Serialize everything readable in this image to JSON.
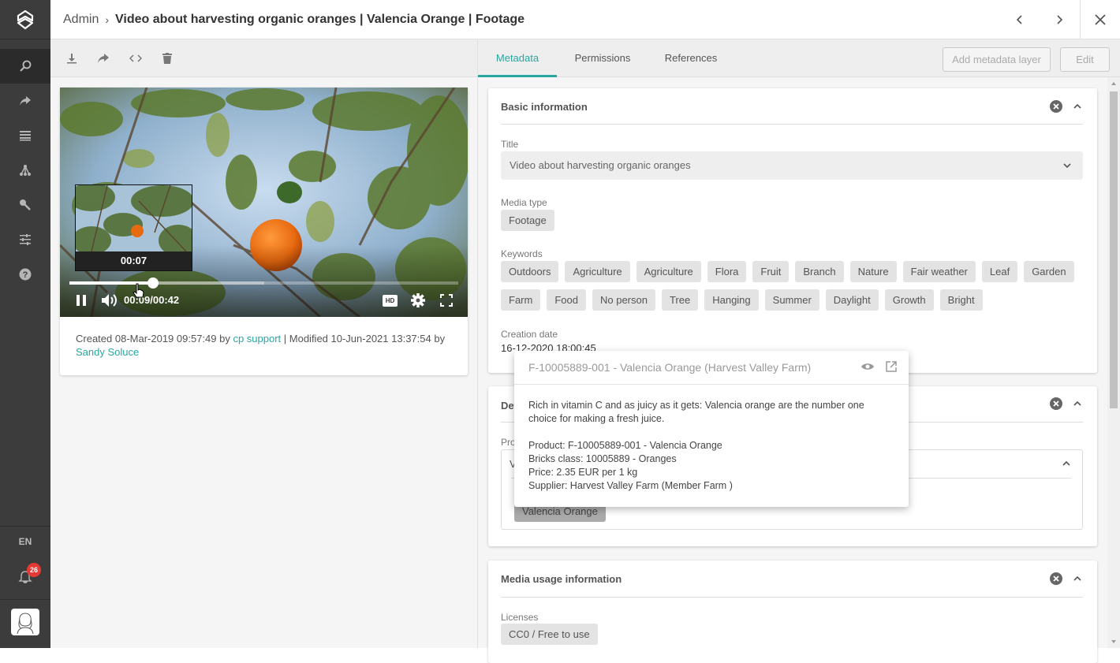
{
  "sidebar": {
    "items": [
      {
        "name": "search",
        "icon": "search-icon"
      },
      {
        "name": "share",
        "icon": "share-icon"
      },
      {
        "name": "list",
        "icon": "list-icon"
      },
      {
        "name": "hierarchy",
        "icon": "hierarchy-icon"
      },
      {
        "name": "key",
        "icon": "key-icon"
      },
      {
        "name": "settings",
        "icon": "sliders-icon"
      },
      {
        "name": "help",
        "icon": "help-icon"
      }
    ],
    "language": "EN",
    "notification_count": "26"
  },
  "header": {
    "breadcrumb_root": "Admin",
    "breadcrumb_sep": "›",
    "title": "Video about harvesting organic oranges | Valencia Orange | Footage"
  },
  "toolbar": {
    "icons": [
      "download-icon",
      "share-icon",
      "embed-code-icon",
      "delete-icon"
    ]
  },
  "video": {
    "preview_time": "00:07",
    "current_time": "00:09",
    "duration": "00:42",
    "time_display": "00:09/00:42",
    "progress_fraction": 0.214,
    "buffered_fraction": 0.5,
    "hd_label": "HD"
  },
  "info": {
    "created_prefix": "Created 08-Mar-2019 09:57:49 by ",
    "created_by": "cp support",
    "modified_text": " | Modified 10-Jun-2021 13:37:54 by ",
    "modified_by": "Sandy Soluce"
  },
  "tabs": [
    {
      "label": "Metadata",
      "active": true
    },
    {
      "label": "Permissions",
      "active": false
    },
    {
      "label": "References",
      "active": false
    }
  ],
  "actions": {
    "add_layer": "Add metadata layer",
    "edit": "Edit"
  },
  "basic_info": {
    "title": "Basic information",
    "title_label": "Title",
    "title_value": "Video about harvesting organic oranges",
    "media_type_label": "Media type",
    "media_type": "Footage",
    "keywords_label": "Keywords",
    "keywords": [
      "Outdoors",
      "Agriculture",
      "Agriculture",
      "Flora",
      "Fruit",
      "Branch",
      "Nature",
      "Fair weather",
      "Leaf",
      "Garden",
      "Farm",
      "Food",
      "No person",
      "Tree",
      "Hanging",
      "Summer",
      "Daylight",
      "Growth",
      "Bright"
    ],
    "creation_date_label": "Creation date",
    "creation_date": "16-12-2020 18:00:45"
  },
  "details": {
    "title_partial": "Det",
    "product_label_partial": "Pro",
    "product_value_partial": "V",
    "chip": "Valencia Orange"
  },
  "popup": {
    "title": "F-10005889-001 - Valencia Orange (Harvest Valley Farm)",
    "description": "Rich in vitamin C and as juicy as it gets: Valencia orange are the number one choice for making a fresh juice.",
    "product": "Product: F-10005889-001 - Valencia Orange",
    "bricks": "Bricks class: 10005889 - Oranges",
    "price": "Price: 2.35 EUR per 1 kg",
    "supplier": "Supplier: Harvest Valley Farm (Member Farm )"
  },
  "usage": {
    "title": "Media usage information",
    "licenses_label": "Licenses",
    "license": "CC0 / Free to use"
  },
  "colors": {
    "accent": "#2aa6a0",
    "sidebar": "#3c3c3c",
    "badge": "#e53935"
  }
}
